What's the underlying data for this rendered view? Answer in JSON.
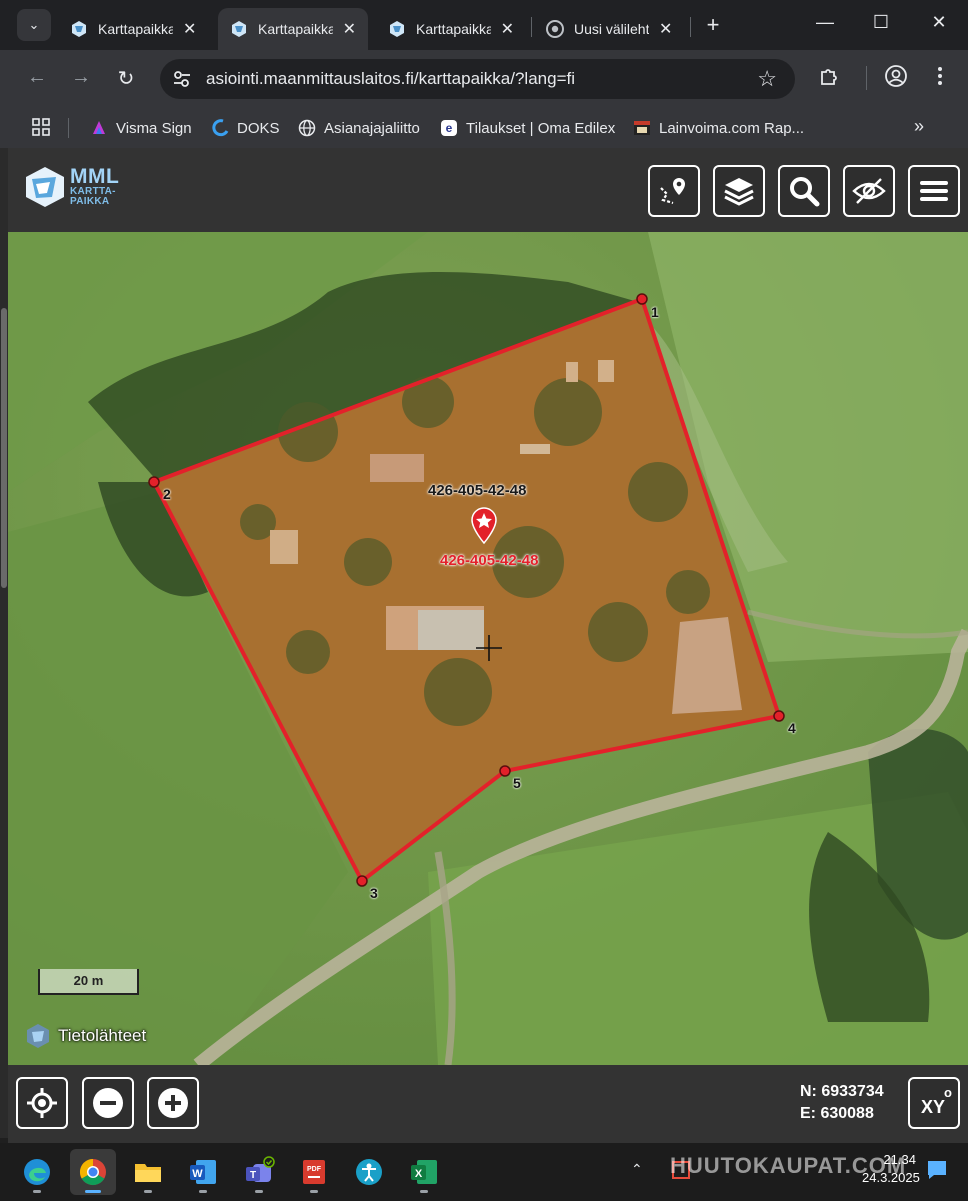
{
  "browser": {
    "tabs": [
      {
        "title": "Karttapaikka",
        "active": false,
        "favicon": "mml-icon"
      },
      {
        "title": "Karttapaikka",
        "active": true,
        "favicon": "mml-icon"
      },
      {
        "title": "Karttapaikka",
        "active": false,
        "favicon": "mml-icon"
      },
      {
        "title": "Uusi välilehti",
        "active": false,
        "favicon": "chrome-icon"
      }
    ],
    "url": "asiointi.maanmittauslaitos.fi/karttapaikka/?lang=fi",
    "bookmarks": [
      {
        "label": "Visma Sign",
        "icon": "visma-sign-icon"
      },
      {
        "label": "DOKS",
        "icon": "doks-icon"
      },
      {
        "label": "Asianajajaliitto",
        "icon": "globe-icon"
      },
      {
        "label": "Tilaukset | Oma Edilex",
        "icon": "edilex-icon"
      },
      {
        "label": "Lainvoima.com Rap...",
        "icon": "lainvoima-icon"
      }
    ]
  },
  "app": {
    "logo_main": "MML",
    "logo_sub_1": "KARTTA-",
    "logo_sub_2": "PAIKKA",
    "header_buttons": [
      "route-pin-icon",
      "layers-icon",
      "search-icon",
      "hide-eye-icon",
      "menu-icon"
    ]
  },
  "map": {
    "parcel_id": "426-405-42-48",
    "parcel_id_marker": "426-405-42-48",
    "corners": [
      "1",
      "2",
      "3",
      "4",
      "5"
    ],
    "scale_label": "20 m",
    "sources_label": "Tietolähteet",
    "colors": {
      "boundary": "#e3212a",
      "fill": "rgba(205,120,40,0.45)"
    }
  },
  "footer": {
    "n_label": "N: 6933734",
    "e_label": "E: 630088",
    "xy_label": "XY"
  },
  "taskbar": {
    "apps": [
      "edge-icon",
      "chrome-icon",
      "file-explorer-icon",
      "word-icon",
      "teams-icon",
      "pdf-icon",
      "accessibility-icon",
      "excel-icon"
    ],
    "time": "21.34",
    "date": "24.3.2025",
    "watermark": "HUUTOKAUPAT.COM"
  }
}
